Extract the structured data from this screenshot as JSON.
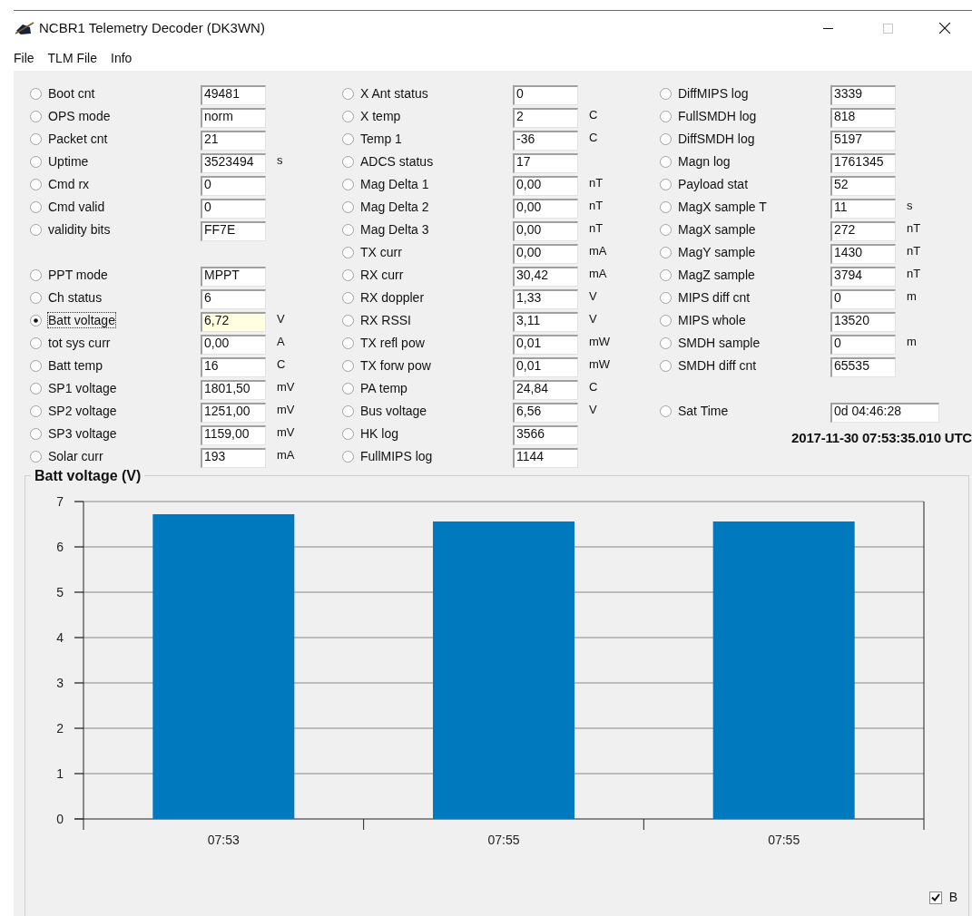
{
  "window": {
    "title": "NCBR1 Telemetry Decoder (DK3WN)"
  },
  "menu": [
    "File",
    "TLM File",
    "Info"
  ],
  "columns": [
    {
      "groups": [
        [
          {
            "label": "Boot cnt",
            "value": "49481",
            "selected": false
          },
          {
            "label": "OPS mode",
            "value": "norm",
            "selected": false
          },
          {
            "label": "Packet cnt",
            "value": "21",
            "selected": false
          },
          {
            "label": "Uptime",
            "value": "3523494",
            "unit": "s",
            "selected": false
          },
          {
            "label": "Cmd rx",
            "value": "0",
            "selected": false
          },
          {
            "label": "Cmd valid",
            "value": "0",
            "selected": false
          },
          {
            "label": "validity bits",
            "value": "FF7E",
            "selected": false
          }
        ],
        [
          {
            "label": "PPT mode",
            "value": "MPPT",
            "selected": false
          },
          {
            "label": "Ch status",
            "value": "6",
            "selected": false
          },
          {
            "label": "Batt voltage",
            "value": "6,72",
            "unit": "V",
            "selected": true
          },
          {
            "label": "tot sys curr",
            "value": "0,00",
            "unit": "A",
            "selected": false
          },
          {
            "label": "Batt temp",
            "value": "16",
            "unit": "C",
            "selected": false
          },
          {
            "label": "SP1 voltage",
            "value": "1801,50",
            "unit": "mV",
            "selected": false
          },
          {
            "label": "SP2 voltage",
            "value": "1251,00",
            "unit": "mV",
            "selected": false
          },
          {
            "label": "SP3 voltage",
            "value": "1159,00",
            "unit": "mV",
            "selected": false
          },
          {
            "label": "Solar curr",
            "value": "193",
            "unit": "mA",
            "selected": false
          }
        ]
      ]
    },
    {
      "groups": [
        [
          {
            "label": "X Ant status",
            "value": "0",
            "selected": false
          },
          {
            "label": "X temp",
            "value": "2",
            "unit": "C",
            "selected": false
          },
          {
            "label": "Temp 1",
            "value": "-36",
            "unit": "C",
            "selected": false
          },
          {
            "label": "ADCS status",
            "value": "17",
            "selected": false
          },
          {
            "label": "Mag Delta 1",
            "value": "0,00",
            "unit": "nT",
            "selected": false
          },
          {
            "label": "Mag Delta 2",
            "value": "0,00",
            "unit": "nT",
            "selected": false
          },
          {
            "label": "Mag Delta 3",
            "value": "0,00",
            "unit": "nT",
            "selected": false
          },
          {
            "label": "TX curr",
            "value": "0,00",
            "unit": "mA",
            "selected": false
          },
          {
            "label": "RX curr",
            "value": "30,42",
            "unit": "mA",
            "selected": false
          },
          {
            "label": "RX doppler",
            "value": "1,33",
            "unit": "V",
            "selected": false
          },
          {
            "label": "RX RSSI",
            "value": "3,11",
            "unit": "V",
            "selected": false
          },
          {
            "label": "TX refl pow",
            "value": "0,01",
            "unit": "mW",
            "selected": false
          },
          {
            "label": "TX forw pow",
            "value": "0,01",
            "unit": "mW",
            "selected": false
          },
          {
            "label": "PA temp",
            "value": "24,84",
            "unit": "C",
            "selected": false
          },
          {
            "label": "Bus voltage",
            "value": "6,56",
            "unit": "V",
            "selected": false
          },
          {
            "label": "HK log",
            "value": "3566",
            "selected": false
          },
          {
            "label": "FullMIPS log",
            "value": "1144",
            "selected": false
          }
        ]
      ]
    },
    {
      "groups": [
        [
          {
            "label": "DiffMIPS log",
            "value": "3339",
            "selected": false
          },
          {
            "label": "FullSMDH log",
            "value": "818",
            "selected": false
          },
          {
            "label": "DiffSMDH log",
            "value": "5197",
            "selected": false
          },
          {
            "label": "Magn log",
            "value": "1761345",
            "selected": false
          },
          {
            "label": "Payload stat",
            "value": "52",
            "selected": false
          },
          {
            "label": "MagX sample T",
            "value": "11",
            "unit": "s",
            "selected": false
          },
          {
            "label": "MagX sample",
            "value": "272",
            "unit": "nT",
            "selected": false
          },
          {
            "label": "MagY sample",
            "value": "1430",
            "unit": "nT",
            "selected": false
          },
          {
            "label": "MagZ sample",
            "value": "3794",
            "unit": "nT",
            "selected": false
          },
          {
            "label": "MIPS diff cnt",
            "value": "0",
            "unit": "m",
            "selected": false
          },
          {
            "label": "MIPS whole",
            "value": "13520",
            "selected": false
          },
          {
            "label": "SMDH sample",
            "value": "0",
            "unit": "m",
            "selected": false
          },
          {
            "label": "SMDH diff cnt",
            "value": "65535",
            "selected": false
          }
        ]
      ]
    }
  ],
  "sat_time": {
    "label": "Sat Time",
    "value": "0d 04:46:28",
    "selected": false
  },
  "timestamp": "2017-11-30 07:53:35.010 UTC",
  "chart": {
    "chart_data": {
      "type": "bar",
      "title": "Batt voltage (V)",
      "categories": [
        "07:53",
        "07:55",
        "07:55"
      ],
      "values": [
        6.72,
        6.56,
        6.56
      ],
      "ylim": [
        0,
        7
      ],
      "yticks": [
        0,
        1,
        2,
        3,
        4,
        5,
        6,
        7
      ],
      "grid": true
    },
    "legend": {
      "label": "B",
      "checked": true
    }
  }
}
